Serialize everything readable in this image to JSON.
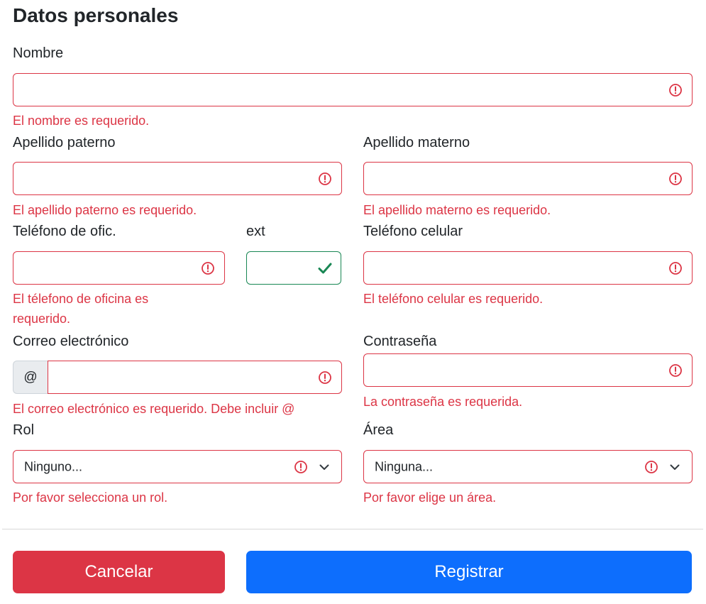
{
  "section_title": "Datos personales",
  "fields": {
    "nombre": {
      "label": "Nombre",
      "value": "",
      "error": "El nombre es requerido."
    },
    "apellido_paterno": {
      "label": "Apellido paterno",
      "value": "",
      "error": "El apellido paterno es requerido."
    },
    "apellido_materno": {
      "label": "Apellido materno",
      "value": "",
      "error": "El apellido materno es requerido."
    },
    "telefono_oficina": {
      "label": "Teléfono de ofic.",
      "value": "",
      "error_line1": "El télefono de oficina es",
      "error_line2": "requerido."
    },
    "ext": {
      "label": "ext",
      "value": ""
    },
    "telefono_celular": {
      "label": "Teléfono celular",
      "value": "",
      "error": "El teléfono celular es requerido."
    },
    "correo": {
      "label": "Correo electrónico",
      "prefix": "@",
      "value": "",
      "error": "El correo electrónico es requerido. Debe incluir @"
    },
    "contrasena": {
      "label": "Contraseña",
      "value": "",
      "error": "La contraseña es requerida."
    },
    "rol": {
      "label": "Rol",
      "selected": "Ninguno...",
      "error": "Por favor selecciona un rol."
    },
    "area": {
      "label": "Área",
      "selected": "Ninguna...",
      "error": "Por favor elige un área."
    }
  },
  "buttons": {
    "cancel": "Cancelar",
    "submit": "Registrar"
  },
  "colors": {
    "error": "#dc3545",
    "valid": "#198754",
    "primary": "#0d6efd",
    "danger": "#dc3545"
  }
}
